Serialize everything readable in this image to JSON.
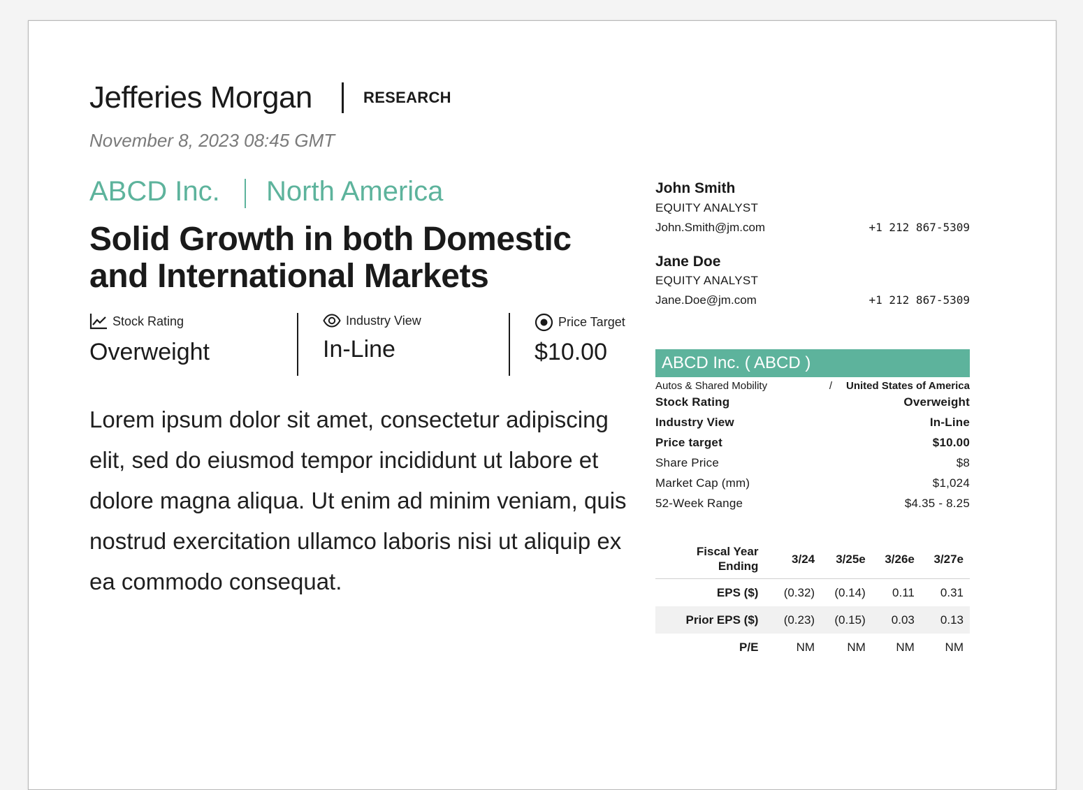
{
  "header": {
    "brand": "Jefferies Morgan",
    "section": "RESEARCH",
    "datetime": "November 8, 2023 08:45 GMT"
  },
  "report": {
    "company": "ABCD Inc.",
    "region": "North America",
    "headline": "Solid Growth in both Domestic and International Markets",
    "body": "Lorem ipsum dolor sit amet, consectetur adipiscing elit, sed do eiusmod tempor incididunt ut labore et dolore magna aliqua. Ut enim ad minim veniam, quis nostrud exercitation ullamco laboris nisi ut aliquip ex ea commodo consequat."
  },
  "metrics": [
    {
      "label": "Stock Rating",
      "value": "Overweight",
      "icon": "line-chart-icon"
    },
    {
      "label": "Industry View",
      "value": "In-Line",
      "icon": "eye-icon"
    },
    {
      "label": "Price Target",
      "value": "$10.00",
      "icon": "target-icon"
    }
  ],
  "analysts": [
    {
      "name": "John Smith",
      "title": "EQUITY ANALYST",
      "email": "John.Smith@jm.com",
      "phone": "+1 212 867-5309"
    },
    {
      "name": "Jane Doe",
      "title": "EQUITY ANALYST",
      "email": "Jane.Doe@jm.com",
      "phone": "+1 212 867-5309"
    }
  ],
  "summary": {
    "ticker_title": "ABCD Inc. ( ABCD )",
    "sector": "Autos & Shared Mobility",
    "divider": "/",
    "country": "United States of America",
    "rows": [
      {
        "label": "Stock Rating",
        "value": "Overweight",
        "bold": true
      },
      {
        "label": "Industry View",
        "value": "In-Line",
        "bold": true
      },
      {
        "label": "Price target",
        "value": "$10.00",
        "bold": true
      },
      {
        "label": "Share Price",
        "value": "$8",
        "bold": false
      },
      {
        "label": "Market Cap (mm)",
        "value": "$1,024",
        "bold": false
      },
      {
        "label": "52-Week Range",
        "value": "$4.35 - 8.25",
        "bold": false
      }
    ]
  },
  "financials": {
    "header_label_line1": "Fiscal Year",
    "header_label_line2": "Ending",
    "columns": [
      "3/24",
      "3/25e",
      "3/26e",
      "3/27e"
    ],
    "rows": [
      {
        "label": "EPS ($)",
        "values": [
          "(0.32)",
          "(0.14)",
          "0.11",
          "0.31"
        ]
      },
      {
        "label": "Prior EPS ($)",
        "values": [
          "(0.23)",
          "(0.15)",
          "0.03",
          "0.13"
        ]
      },
      {
        "label": "P/E",
        "values": [
          "NM",
          "NM",
          "NM",
          "NM"
        ]
      }
    ]
  },
  "colors": {
    "accent": "#5db39c",
    "text": "#1a1a1a",
    "muted": "#7a7a7a"
  }
}
